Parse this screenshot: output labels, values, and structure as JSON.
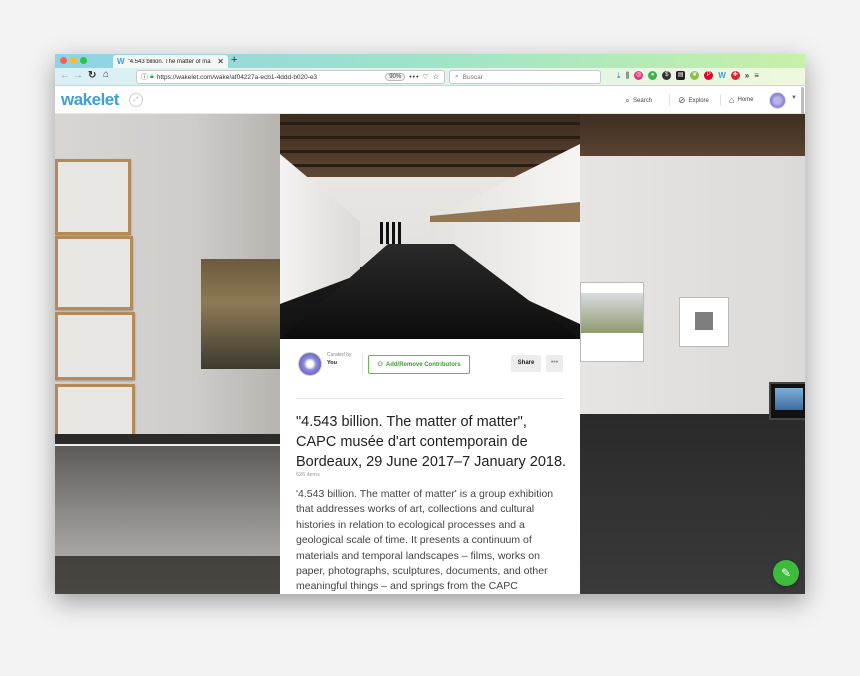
{
  "browser": {
    "tab_title": "\"4.543 billion. The matter of ma",
    "tab_favicon": "W",
    "url": "https://wakelet.com/wake/af04227a-ecb1-4ddd-b020-e3",
    "zoom": "90%",
    "search_placeholder": "Buscar",
    "traffic_colors": [
      "#ff5f57",
      "#febc2e",
      "#28c840"
    ]
  },
  "header": {
    "logo": "wakelet",
    "nav": {
      "search": "Search",
      "explore": "Explore",
      "home": "Home"
    }
  },
  "card": {
    "curated_by": "Curated by",
    "curator": "You",
    "contributors_button": "Add/Remove Contributors",
    "share_button": "Share",
    "more_button": "•••",
    "title": "\"4.543 billion. The matter of matter\", CAPC musée d'art contemporain de Bordeaux, 29 June 2017–7 January 2018.",
    "item_count": "626 items",
    "description": "'4.543 billion. The matter of matter' is a group exhibition that addresses works of art, collections and cultural histories in relation to ecological processes and a geological scale of time. It presents a continuum of materials and temporal landscapes – films, works on paper, photographs, sculptures, documents, and other meaningful things – and springs from the CAPC"
  },
  "colors": {
    "brand": "#3da0d6",
    "accent_green": "#3dbb3a"
  }
}
